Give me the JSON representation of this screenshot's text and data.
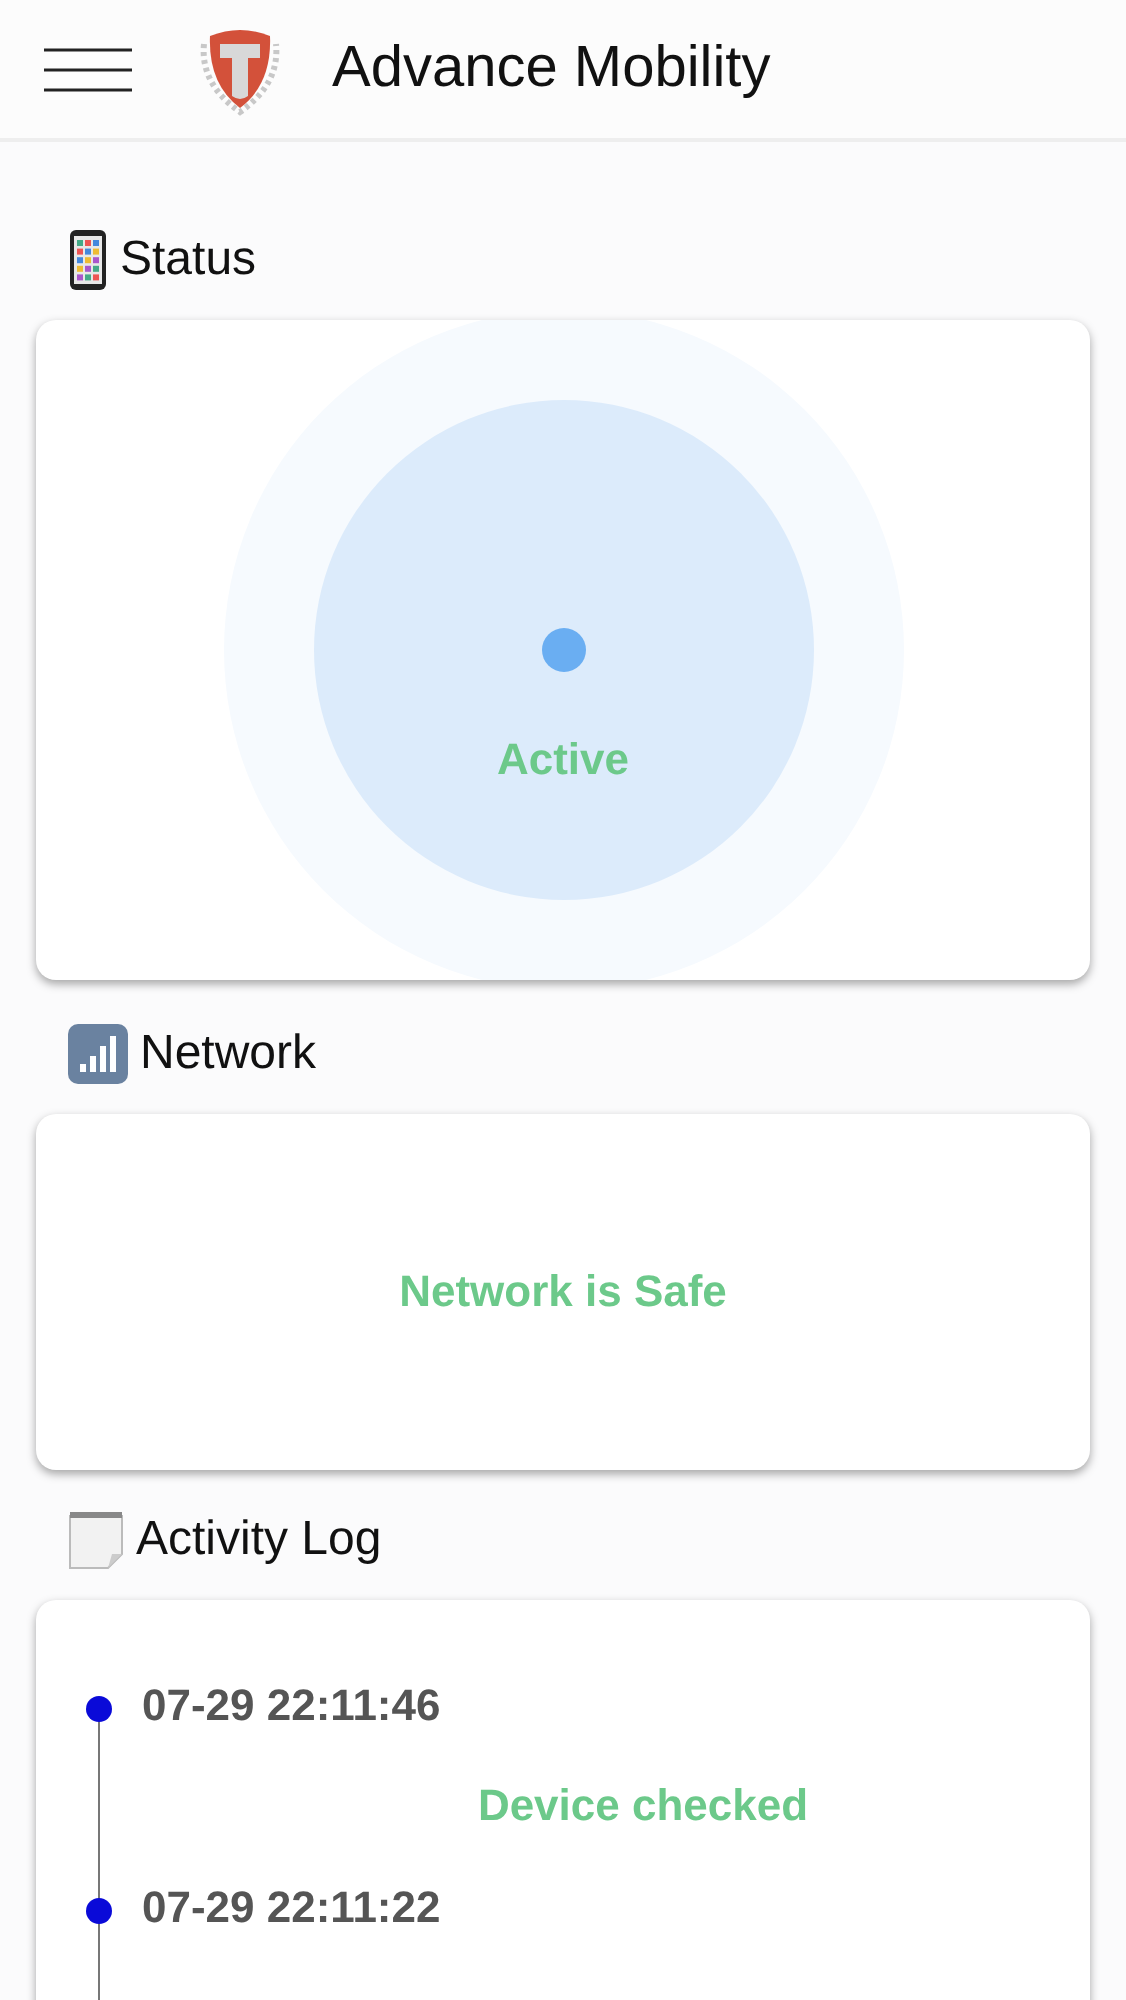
{
  "header": {
    "title": "Advance Mobility"
  },
  "status": {
    "title": "Status",
    "label": "Active"
  },
  "network": {
    "title": "Network",
    "message": "Network is Safe"
  },
  "activity_log": {
    "title": "Activity Log",
    "entries": [
      {
        "time": "07-29 22:11:46",
        "event": "Device checked"
      },
      {
        "time": "07-29 22:11:22"
      }
    ]
  }
}
